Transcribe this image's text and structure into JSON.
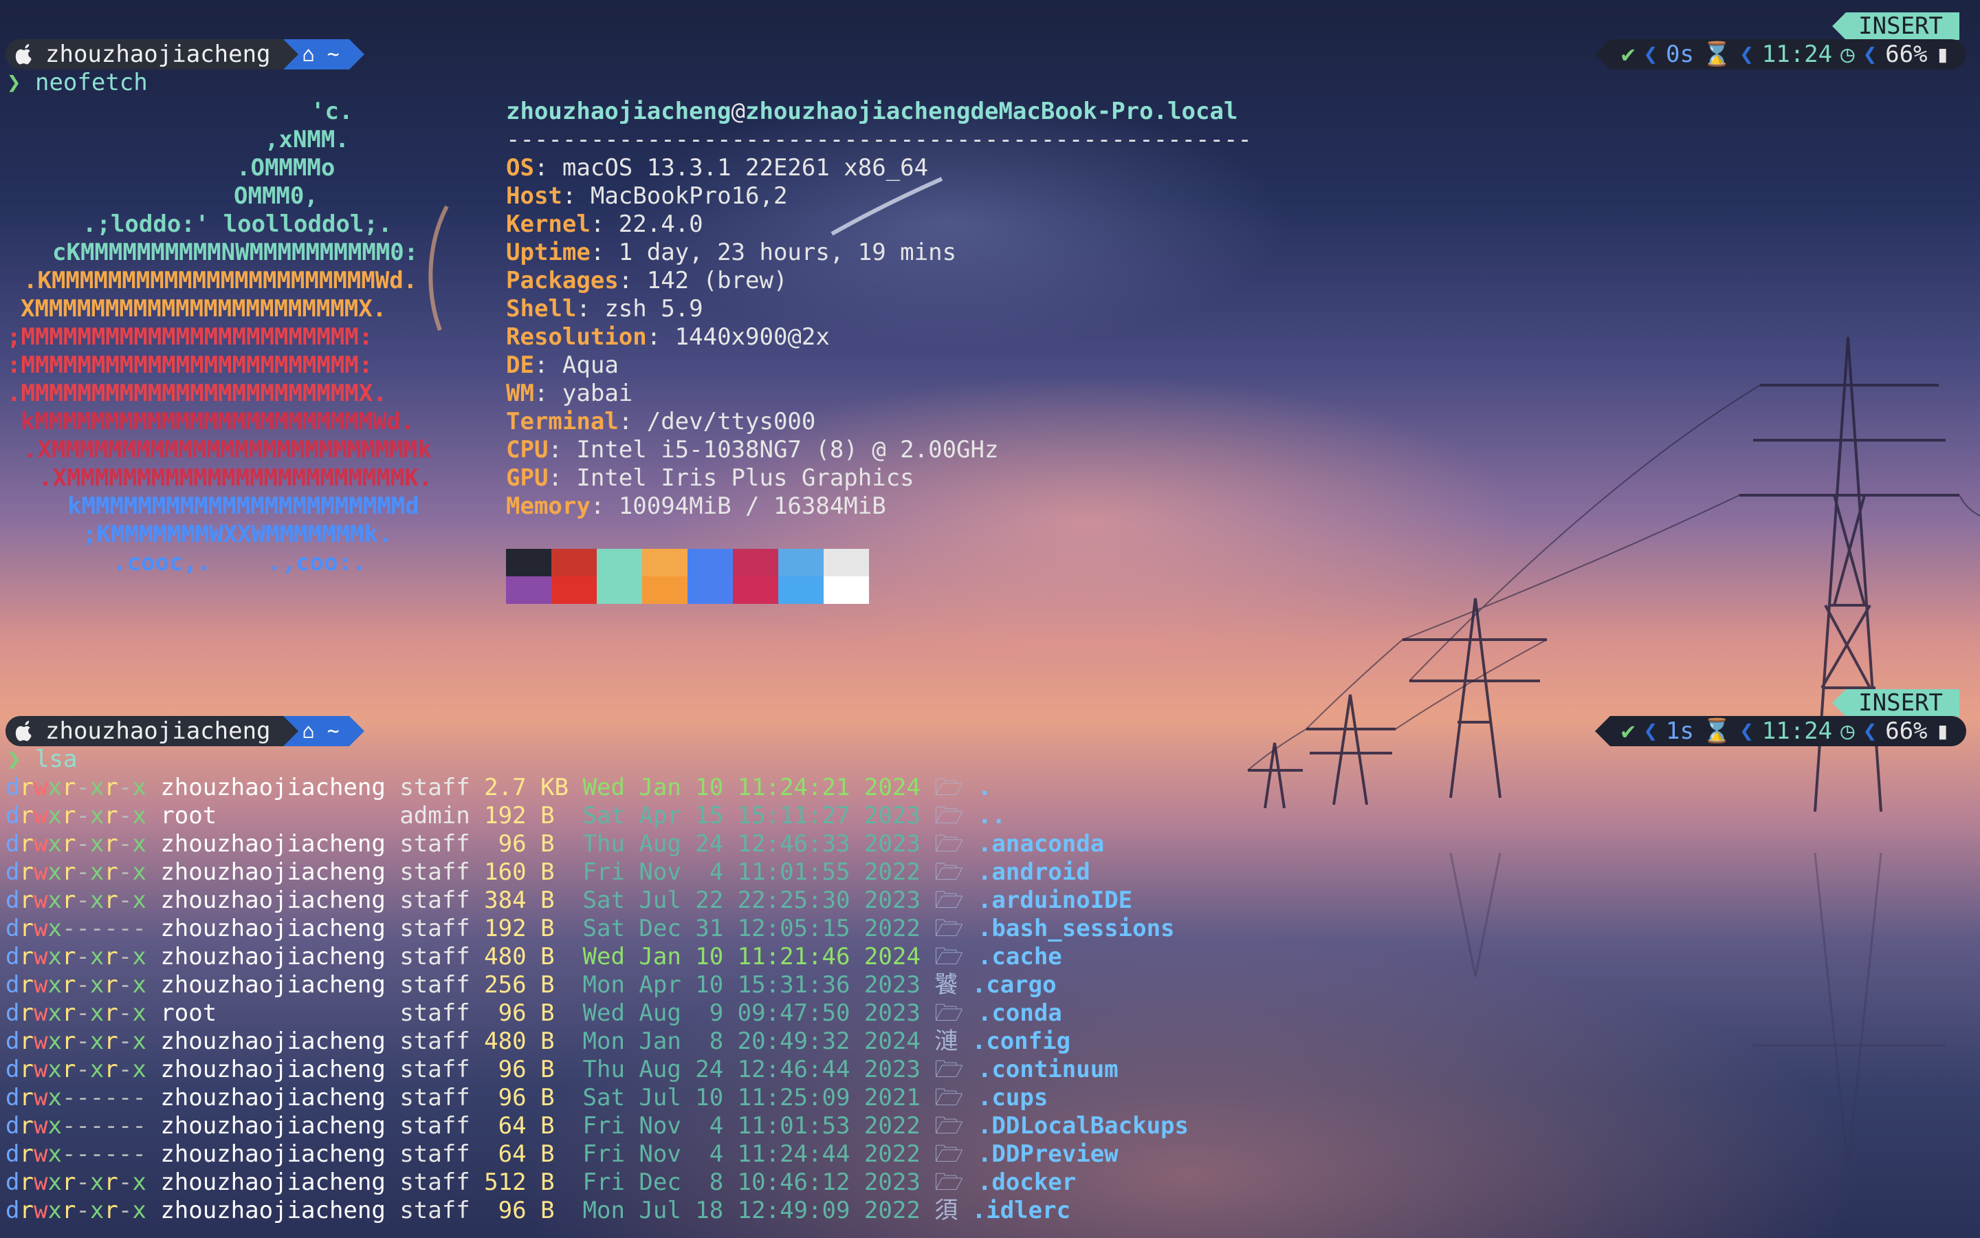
{
  "prompt_top": {
    "user": "zhouzhaojiacheng",
    "home": "~",
    "mode": "INSERT",
    "status": {
      "check": "✔",
      "elapsed": "0s",
      "time": "11:24",
      "battery": "66%"
    },
    "caret": "❯",
    "command": "neofetch"
  },
  "neofetch": {
    "ascii": [
      {
        "text": "'c.",
        "color": "#7fd8c0"
      },
      {
        "text": ",xNMM.",
        "color": "#7fd8c0"
      },
      {
        "text": ".OMMMMo",
        "color": "#7fd8c0"
      },
      {
        "text": "OMMM0,",
        "color": "#7fd8c0"
      },
      {
        "text": ".;loddo:' loolloddol;.",
        "color": "#7fd8c0"
      },
      {
        "text": "cKMMMMMMMMMMNWMMMMMMMMMM0:",
        "color": "#7fd8c0"
      },
      {
        "text": ".KMMMMMMMMMMMMMMMMMMMMMMMWd.",
        "color": "#f5a84a"
      },
      {
        "text": "XMMMMMMMMMMMMMMMMMMMMMMMX.",
        "color": "#f5a84a"
      },
      {
        "text": ";MMMMMMMMMMMMMMMMMMMMMMMM:",
        "color": "#e8414a"
      },
      {
        "text": ":MMMMMMMMMMMMMMMMMMMMMMMM:",
        "color": "#e8414a"
      },
      {
        "text": ".MMMMMMMMMMMMMMMMMMMMMMMMX.",
        "color": "#e8414a"
      },
      {
        "text": "kMMMMMMMMMMMMMMMMMMMMMMMMWd.",
        "color": "#d0304a"
      },
      {
        "text": ".XMMMMMMMMMMMMMMMMMMMMMMMMMMk",
        "color": "#d0304a"
      },
      {
        "text": ".XMMMMMMMMMMMMMMMMMMMMMMMMK.",
        "color": "#d0304a"
      },
      {
        "text": "kMMMMMMMMMMMMMMMMMMMMMMMd",
        "color": "#4a90ff"
      },
      {
        "text": ";KMMMMMMMWXXWMMMMMMMk.",
        "color": "#4a90ff"
      },
      {
        "text": ".cooc,.    .,coo:.",
        "color": "#4a90ff"
      }
    ],
    "user": "zhouzhaojiacheng",
    "at": "@",
    "host": "zhouzhaojiachengdeMacBook-Pro.local",
    "separator": "-----------------------------------------------------",
    "fields": [
      {
        "key": "OS",
        "value": "macOS 13.3.1 22E261 x86_64"
      },
      {
        "key": "Host",
        "value": "MacBookPro16,2"
      },
      {
        "key": "Kernel",
        "value": "22.4.0"
      },
      {
        "key": "Uptime",
        "value": "1 day, 23 hours, 19 mins"
      },
      {
        "key": "Packages",
        "value": "142 (brew)"
      },
      {
        "key": "Shell",
        "value": "zsh 5.9"
      },
      {
        "key": "Resolution",
        "value": "1440x900@2x"
      },
      {
        "key": "DE",
        "value": "Aqua"
      },
      {
        "key": "WM",
        "value": "yabai"
      },
      {
        "key": "Terminal",
        "value": "/dev/ttys000"
      },
      {
        "key": "CPU",
        "value": "Intel i5-1038NG7 (8) @ 2.00GHz"
      },
      {
        "key": "GPU",
        "value": "Intel Iris Plus Graphics"
      },
      {
        "key": "Memory",
        "value": "10094MiB / 16384MiB"
      }
    ],
    "palette_top": [
      "#232630",
      "#c9362c",
      "#7fd8c0",
      "#f5a84a",
      "#4a7ff0",
      "#c4305a",
      "#5aaae8",
      "#e6e6e6"
    ],
    "palette_bottom": [
      "#8a4aa8",
      "#e0302a",
      "#7fd8c0",
      "#f59a38",
      "#4a7ff0",
      "#d02c58",
      "#4aa8f0",
      "#ffffff"
    ]
  },
  "prompt_bottom": {
    "user": "zhouzhaojiacheng",
    "home": "~",
    "mode": "INSERT",
    "status": {
      "check": "✔",
      "elapsed": "1s",
      "time": "11:24",
      "battery": "66%"
    },
    "caret": "❯",
    "command": "lsa"
  },
  "listing": [
    {
      "perm": "drwxr-xr-x",
      "owner": "zhouzhaojiacheng",
      "group": "staff",
      "size": "2.7",
      "unit": "KB",
      "date": "Wed Jan 10 11:24:21 2024",
      "recent": true,
      "icon": "🗁",
      "name": "."
    },
    {
      "perm": "drwxr-xr-x",
      "owner": "root",
      "group": "admin",
      "size": "192",
      "unit": "B",
      "date": "Sat Apr 15 15:11:27 2023",
      "recent": false,
      "icon": "🗁",
      "name": ".."
    },
    {
      "perm": "drwxr-xr-x",
      "owner": "zhouzhaojiacheng",
      "group": "staff",
      "size": "96",
      "unit": "B",
      "date": "Thu Aug 24 12:46:33 2023",
      "recent": false,
      "icon": "🗁",
      "name": ".anaconda"
    },
    {
      "perm": "drwxr-xr-x",
      "owner": "zhouzhaojiacheng",
      "group": "staff",
      "size": "160",
      "unit": "B",
      "date": "Fri Nov  4 11:01:55 2022",
      "recent": false,
      "icon": "🗁",
      "name": ".android"
    },
    {
      "perm": "drwxr-xr-x",
      "owner": "zhouzhaojiacheng",
      "group": "staff",
      "size": "384",
      "unit": "B",
      "date": "Sat Jul 22 22:25:30 2023",
      "recent": false,
      "icon": "🗁",
      "name": ".arduinoIDE"
    },
    {
      "perm": "drwx------",
      "owner": "zhouzhaojiacheng",
      "group": "staff",
      "size": "192",
      "unit": "B",
      "date": "Sat Dec 31 12:05:15 2022",
      "recent": false,
      "icon": "🗁",
      "name": ".bash_sessions"
    },
    {
      "perm": "drwxr-xr-x",
      "owner": "zhouzhaojiacheng",
      "group": "staff",
      "size": "480",
      "unit": "B",
      "date": "Wed Jan 10 11:21:46 2024",
      "recent": true,
      "icon": "🗁",
      "name": ".cache"
    },
    {
      "perm": "drwxr-xr-x",
      "owner": "zhouzhaojiacheng",
      "group": "staff",
      "size": "256",
      "unit": "B",
      "date": "Mon Apr 10 15:31:36 2023",
      "recent": false,
      "icon": "饕",
      "name": ".cargo"
    },
    {
      "perm": "drwxr-xr-x",
      "owner": "root",
      "group": "staff",
      "size": "96",
      "unit": "B",
      "date": "Wed Aug  9 09:47:50 2023",
      "recent": false,
      "icon": "🗁",
      "name": ".conda"
    },
    {
      "perm": "drwxr-xr-x",
      "owner": "zhouzhaojiacheng",
      "group": "staff",
      "size": "480",
      "unit": "B",
      "date": "Mon Jan  8 20:49:32 2024",
      "recent": false,
      "icon": "漣",
      "name": ".config"
    },
    {
      "perm": "drwxr-xr-x",
      "owner": "zhouzhaojiacheng",
      "group": "staff",
      "size": "96",
      "unit": "B",
      "date": "Thu Aug 24 12:46:44 2023",
      "recent": false,
      "icon": "🗁",
      "name": ".continuum"
    },
    {
      "perm": "drwx------",
      "owner": "zhouzhaojiacheng",
      "group": "staff",
      "size": "96",
      "unit": "B",
      "date": "Sat Jul 10 11:25:09 2021",
      "recent": false,
      "icon": "🗁",
      "name": ".cups"
    },
    {
      "perm": "drwx------",
      "owner": "zhouzhaojiacheng",
      "group": "staff",
      "size": "64",
      "unit": "B",
      "date": "Fri Nov  4 11:01:53 2022",
      "recent": false,
      "icon": "🗁",
      "name": ".DDLocalBackups"
    },
    {
      "perm": "drwx------",
      "owner": "zhouzhaojiacheng",
      "group": "staff",
      "size": "64",
      "unit": "B",
      "date": "Fri Nov  4 11:24:44 2022",
      "recent": false,
      "icon": "🗁",
      "name": ".DDPreview"
    },
    {
      "perm": "drwxr-xr-x",
      "owner": "zhouzhaojiacheng",
      "group": "staff",
      "size": "512",
      "unit": "B",
      "date": "Fri Dec  8 10:46:12 2023",
      "recent": false,
      "icon": "🗁",
      "name": ".docker"
    },
    {
      "perm": "drwxr-xr-x",
      "owner": "zhouzhaojiacheng",
      "group": "staff",
      "size": "96",
      "unit": "B",
      "date": "Mon Jul 18 12:49:09 2022",
      "recent": false,
      "icon": "須",
      "name": ".idlerc"
    }
  ]
}
